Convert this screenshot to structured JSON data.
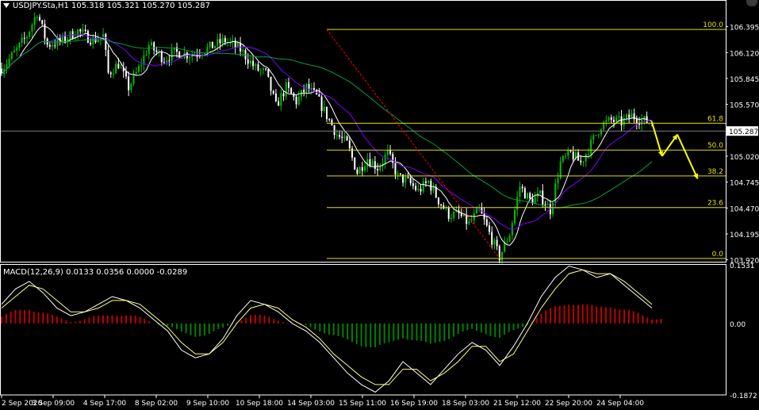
{
  "header": {
    "symbol_info": "USDJPY.Sta,H1",
    "ohlc": "105.318 105.321 105.270 105.287",
    "macd_info": "MACD(12,26,9) 0.0133 0.0356 0.0000 -0.0289"
  },
  "colors": {
    "background": "#000000",
    "bull": "#00c000",
    "bear": "#ffffff",
    "ma_fast": "#ffffff",
    "ma_mid": "#8000ff",
    "ma_slow": "#00a040",
    "fib": "#e0e000",
    "trend": "#ff0000",
    "arrow": "#ffff00",
    "hist_pos": "#c00000",
    "hist_neg": "#008000",
    "signal": "#ffff80",
    "macd_line": "#ffffff",
    "price_tag": "#ffffff"
  },
  "chart_data": [
    {
      "type": "candlestick",
      "title": "USDJPY.Sta,H1",
      "ylim": [
        103.9,
        106.56
      ],
      "y_ticks": [
        "106.395",
        "106.120",
        "105.845",
        "105.570",
        "105.287",
        "105.020",
        "104.745",
        "104.470",
        "104.195",
        "103.920"
      ],
      "current_price": "105.287",
      "x_ticks": [
        "2 Sep 2020",
        "3 Sep 09:00",
        "4 Sep 17:00",
        "8 Sep 02:00",
        "9 Sep 10:00",
        "10 Sep 18:00",
        "14 Sep 03:00",
        "15 Sep 11:00",
        "16 Sep 19:00",
        "18 Sep 03:00",
        "21 Sep 12:00",
        "22 Sep 20:00",
        "24 Sep 04:00"
      ],
      "price_path": [
        [
          0,
          105.95
        ],
        [
          3,
          106.15
        ],
        [
          5,
          106.3
        ],
        [
          7,
          106.55
        ],
        [
          9,
          106.2
        ],
        [
          12,
          106.25
        ],
        [
          15,
          106.35
        ],
        [
          18,
          106.25
        ],
        [
          20,
          106.3
        ],
        [
          21,
          105.9
        ],
        [
          23,
          106.0
        ],
        [
          25,
          105.75
        ],
        [
          27,
          105.95
        ],
        [
          29,
          106.2
        ],
        [
          32,
          106.05
        ],
        [
          34,
          106.12
        ],
        [
          37,
          106.1
        ],
        [
          40,
          106.15
        ],
        [
          44,
          106.25
        ],
        [
          47,
          106.15
        ],
        [
          50,
          105.95
        ],
        [
          52,
          105.9
        ],
        [
          54,
          105.55
        ],
        [
          56,
          105.75
        ],
        [
          58,
          105.6
        ],
        [
          60,
          105.75
        ],
        [
          62,
          105.65
        ],
        [
          64,
          105.45
        ],
        [
          66,
          105.25
        ],
        [
          68,
          105.15
        ],
        [
          70,
          104.85
        ],
        [
          72,
          105.0
        ],
        [
          74,
          104.9
        ],
        [
          76,
          105.05
        ],
        [
          78,
          104.8
        ],
        [
          80,
          104.75
        ],
        [
          82,
          104.65
        ],
        [
          84,
          104.75
        ],
        [
          86,
          104.55
        ],
        [
          88,
          104.4
        ],
        [
          90,
          104.4
        ],
        [
          92,
          104.3
        ],
        [
          94,
          104.45
        ],
        [
          96,
          104.2
        ],
        [
          98,
          103.95
        ],
        [
          100,
          104.2
        ],
        [
          102,
          104.7
        ],
        [
          104,
          104.55
        ],
        [
          106,
          104.6
        ],
        [
          108,
          104.45
        ],
        [
          110,
          104.95
        ],
        [
          112,
          105.05
        ],
        [
          114,
          104.95
        ],
        [
          116,
          105.15
        ],
        [
          118,
          105.35
        ],
        [
          120,
          105.4
        ],
        [
          122,
          105.38
        ],
        [
          124,
          105.45
        ],
        [
          126,
          105.4
        ],
        [
          128,
          105.38
        ]
      ],
      "moving_averages": [
        {
          "name": "MA fast",
          "color": "#ffffff"
        },
        {
          "name": "MA mid",
          "color": "#8000ff"
        },
        {
          "name": "MA slow",
          "color": "#00a040"
        }
      ],
      "fibonacci": {
        "levels": [
          {
            "label": "100.0",
            "price": 106.365
          },
          {
            "label": "61.8",
            "price": 105.37
          },
          {
            "label": "50.0",
            "price": 105.085
          },
          {
            "label": "38.2",
            "price": 104.81
          },
          {
            "label": "23.6",
            "price": 104.475
          },
          {
            "label": "0.0",
            "price": 103.935
          }
        ]
      },
      "trendline": {
        "from": [
          64,
          106.365
        ],
        "to": [
          98,
          103.935
        ]
      },
      "forecast_arrow": [
        [
          128,
          105.38
        ],
        [
          130,
          105.02
        ],
        [
          133,
          105.25
        ],
        [
          137,
          104.78
        ]
      ]
    },
    {
      "type": "bar",
      "title": "MACD(12,26,9)",
      "ylim": [
        -0.1872,
        0.1531
      ],
      "y_ticks": [
        "0.1531",
        "0.00",
        "-0.1872"
      ],
      "values": {
        "macd": [
          0.05,
          0.09,
          0.11,
          0.08,
          0.04,
          0.02,
          0.03,
          0.05,
          0.07,
          0.06,
          0.04,
          0.01,
          -0.02,
          -0.07,
          -0.09,
          -0.08,
          -0.04,
          0.02,
          0.06,
          0.05,
          0.03,
          0.0,
          -0.02,
          -0.05,
          -0.09,
          -0.13,
          -0.16,
          -0.18,
          -0.15,
          -0.1,
          -0.13,
          -0.16,
          -0.12,
          -0.08,
          -0.05,
          -0.07,
          -0.11,
          -0.06,
          0.0,
          0.07,
          0.12,
          0.15,
          0.14,
          0.12,
          0.13,
          0.1,
          0.07,
          0.04
        ],
        "signal": [
          0.04,
          0.07,
          0.1,
          0.09,
          0.06,
          0.03,
          0.03,
          0.04,
          0.06,
          0.06,
          0.05,
          0.02,
          -0.01,
          -0.05,
          -0.08,
          -0.08,
          -0.05,
          0.0,
          0.04,
          0.05,
          0.04,
          0.01,
          -0.01,
          -0.04,
          -0.08,
          -0.11,
          -0.14,
          -0.16,
          -0.16,
          -0.12,
          -0.12,
          -0.15,
          -0.13,
          -0.1,
          -0.06,
          -0.06,
          -0.1,
          -0.08,
          -0.02,
          0.04,
          0.09,
          0.13,
          0.14,
          0.13,
          0.13,
          0.11,
          0.08,
          0.05
        ]
      }
    }
  ]
}
